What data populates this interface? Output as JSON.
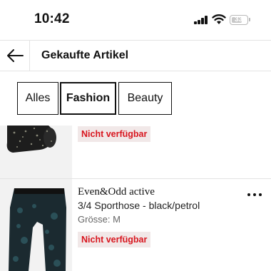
{
  "status_bar": {
    "time": "10:42",
    "battery_level": "33"
  },
  "header": {
    "title": "Gekaufte Artikel"
  },
  "tabs": [
    {
      "label": "Alles",
      "active": false
    },
    {
      "label": "Fashion",
      "active": true
    },
    {
      "label": "Beauty",
      "active": false
    }
  ],
  "items": [
    {
      "status": "Nicht verfügbar"
    },
    {
      "brand": "Even&Odd active",
      "name": "3/4 Sporthose - black/petrol",
      "size": "Grösse: M",
      "status": "Nicht verfügbar"
    }
  ],
  "colors": {
    "accent_text": "#d8151e",
    "badge_bg": "#f1e8e8",
    "thumb_bg": "#f2f2f2"
  }
}
